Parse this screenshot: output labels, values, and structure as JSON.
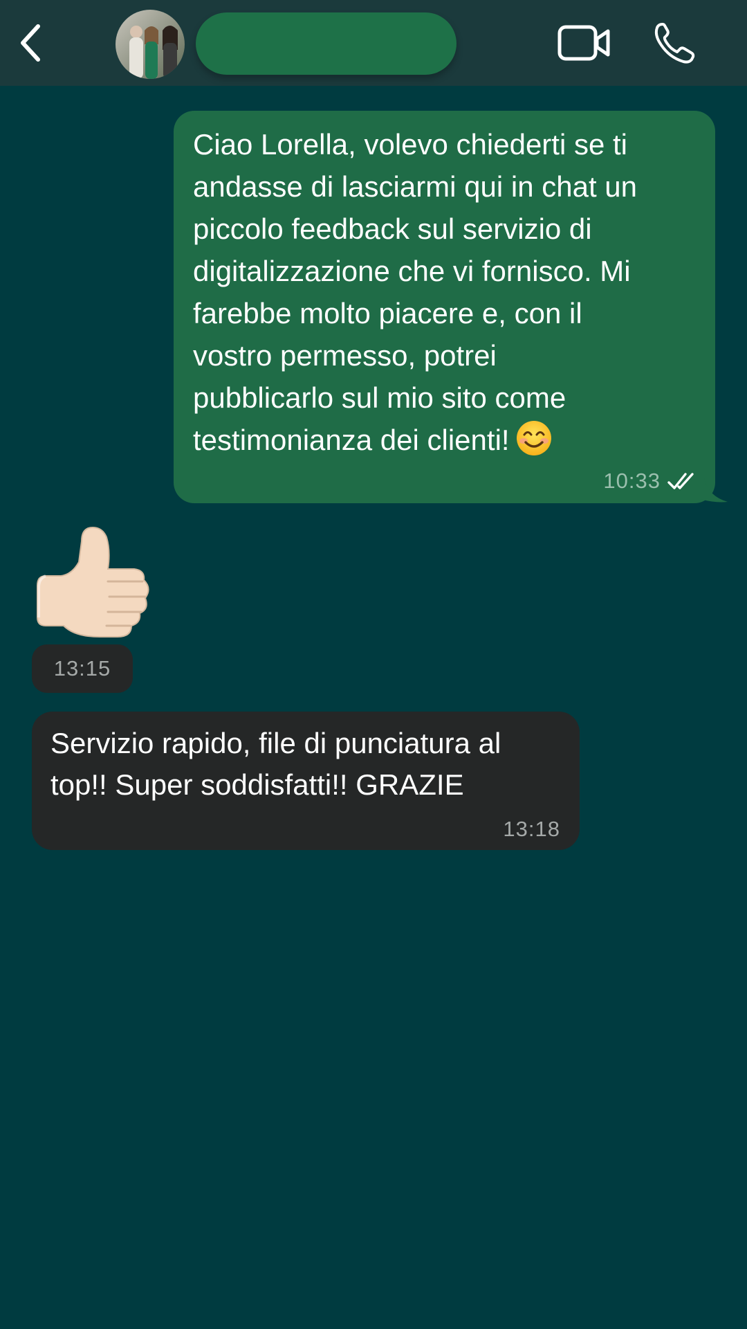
{
  "header": {
    "contact_name": "",
    "icons": {
      "back": "chevron-left-icon",
      "video": "video-camera-icon",
      "call": "phone-icon"
    },
    "colors": {
      "header_bg": "#1b3a3c",
      "name_pill": "#1e7148"
    }
  },
  "chat": {
    "background": "#003b40",
    "messages": [
      {
        "direction": "outgoing",
        "text": "Ciao Lorella, volevo chiederti se ti\nandasse di lasciarmi qui in chat un\npiccolo feedback sul servizio di\ndigitalizzazione che vi fornisco. Mi\nfarebbe molto piacere e, con il\nvostro permesso, potrei\npubblicarlo sul mio sito come\ntestimonianza dei clienti!",
        "emoji": "smiling-face-icon",
        "time": "10:33",
        "status": "read",
        "bubble_color": "#1f6c47"
      },
      {
        "direction": "incoming",
        "sticker": "thumbs-up-icon",
        "time": "13:15"
      },
      {
        "direction": "incoming",
        "text": "Servizio rapido, file di punciatura al\ntop!! Super soddisfatti!! GRAZIE",
        "time": "13:18",
        "bubble_color": "#252727"
      }
    ]
  }
}
